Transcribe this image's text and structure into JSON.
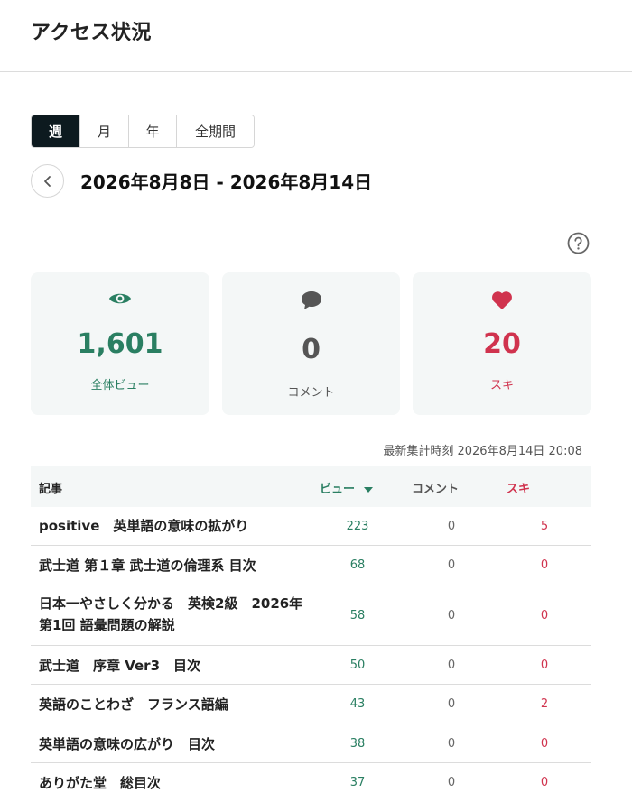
{
  "page": {
    "title": "アクセス状況"
  },
  "period_tabs": [
    {
      "label": "週",
      "active": true
    },
    {
      "label": "月",
      "active": false
    },
    {
      "label": "年",
      "active": false
    },
    {
      "label": "全期間",
      "active": false
    }
  ],
  "date_range": "2026年8月8日 - 2026年8月14日",
  "stats": {
    "views": {
      "value": "1,601",
      "label": "全体ビュー",
      "icon": "eye-icon"
    },
    "comments": {
      "value": "0",
      "label": "コメント",
      "icon": "comment-icon"
    },
    "likes": {
      "value": "20",
      "label": "スキ",
      "icon": "heart-icon"
    }
  },
  "updated_at": "最新集計時刻 2026年8月14日 20:08",
  "table": {
    "headers": {
      "title": "記事",
      "views": "ビュー",
      "comments": "コメント",
      "likes": "スキ"
    },
    "rows": [
      {
        "title": "positive　英単語の意味の拡がり",
        "views": "223",
        "comments": "0",
        "likes": "5"
      },
      {
        "title": "武士道 第１章 武士道の倫理系 目次",
        "views": "68",
        "comments": "0",
        "likes": "0"
      },
      {
        "title": "日本一やさしく分かる　英検2級　2026年 第1回 語彙問題の解説",
        "views": "58",
        "comments": "0",
        "likes": "0"
      },
      {
        "title": "武士道　序章 Ver3　目次",
        "views": "50",
        "comments": "0",
        "likes": "0"
      },
      {
        "title": "英語のことわざ　フランス語編",
        "views": "43",
        "comments": "0",
        "likes": "2"
      },
      {
        "title": "英単語の意味の広がり　目次",
        "views": "38",
        "comments": "0",
        "likes": "0"
      },
      {
        "title": "ありがた堂　総目次",
        "views": "37",
        "comments": "0",
        "likes": "0"
      }
    ]
  },
  "colors": {
    "views": "#2a7f62",
    "comments": "#555555",
    "likes": "#d0334e",
    "active_tab": "#0d1a1f",
    "card_bg": "#f4f7f7"
  }
}
